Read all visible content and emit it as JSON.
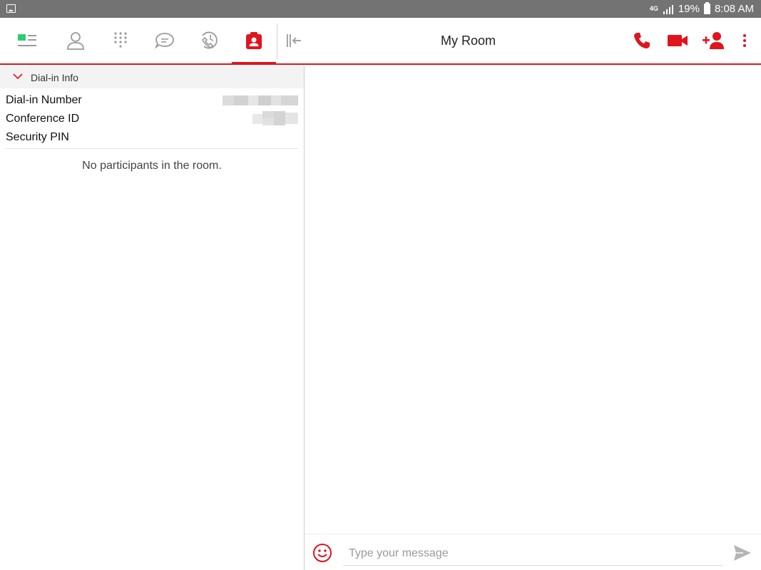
{
  "status_bar": {
    "network": "4G",
    "battery": "19%",
    "time": "8:08 AM"
  },
  "toolbar": {
    "tabs": [
      {
        "name": "dashboard",
        "icon": "dashboard-icon"
      },
      {
        "name": "contacts",
        "icon": "person-icon"
      },
      {
        "name": "dialpad",
        "icon": "dialpad-icon"
      },
      {
        "name": "messages",
        "icon": "chat-bubble-icon"
      },
      {
        "name": "call-history",
        "icon": "call-history-icon"
      },
      {
        "name": "my-room",
        "icon": "room-contact-icon",
        "active": true
      }
    ],
    "collapse_icon": "collapse-panel-icon",
    "title": "My Room",
    "actions": [
      {
        "name": "audio-call",
        "icon": "phone-icon"
      },
      {
        "name": "video-call",
        "icon": "video-camera-icon"
      },
      {
        "name": "add-participant",
        "icon": "add-person-icon"
      },
      {
        "name": "more-options",
        "icon": "more-vertical-icon"
      }
    ]
  },
  "dial_in": {
    "section_label": "Dial-in Info",
    "rows": [
      {
        "label": "Dial-in Number"
      },
      {
        "label": "Conference ID"
      },
      {
        "label": "Security PIN"
      }
    ]
  },
  "participants": {
    "empty_text": "No participants in the room."
  },
  "composer": {
    "placeholder": "Type your message",
    "emoji_icon": "smiley-icon",
    "send_icon": "send-icon"
  },
  "colors": {
    "accent": "#e0141e",
    "active_green": "#2ecc71",
    "status_bar": "#737373",
    "icon_gray": "#9a9a9a"
  }
}
